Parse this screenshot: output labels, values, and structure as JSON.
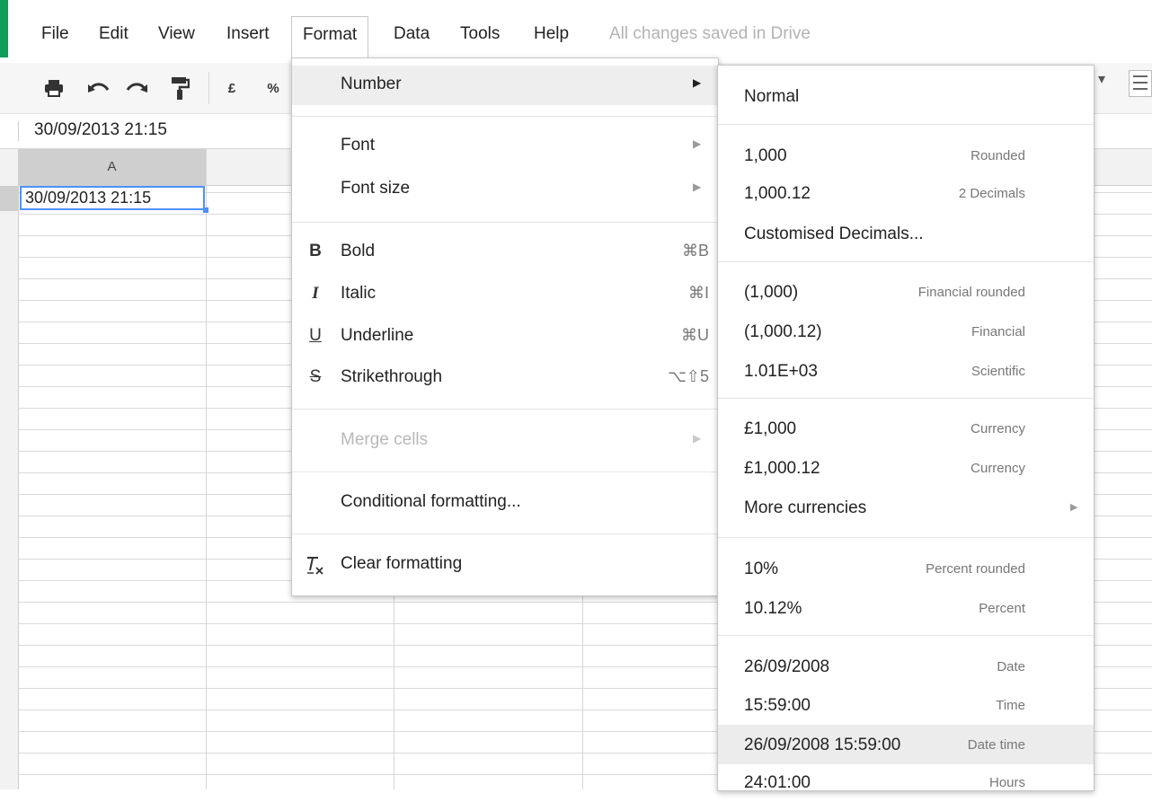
{
  "menubar": {
    "items": [
      "File",
      "Edit",
      "View",
      "Insert",
      "Format",
      "Data",
      "Tools",
      "Help"
    ],
    "active": "Format",
    "save_status": "All changes saved in Drive"
  },
  "toolbar": {
    "currency_label": "£",
    "percent_label": "%"
  },
  "formula_bar": {
    "value": "30/09/2013 21:15"
  },
  "sheet": {
    "column_a": "A",
    "cell_a1": "30/09/2013 21:15"
  },
  "format_menu": {
    "number": "Number",
    "font": "Font",
    "font_size": "Font size",
    "bold": "Bold",
    "bold_shortcut": "⌘B",
    "italic": "Italic",
    "italic_shortcut": "⌘I",
    "underline": "Underline",
    "underline_shortcut": "⌘U",
    "strikethrough": "Strikethrough",
    "strikethrough_shortcut": "⌥⇧5",
    "merge_cells": "Merge cells",
    "conditional_formatting": "Conditional formatting...",
    "clear_formatting": "Clear formatting",
    "icon_bold": "B",
    "icon_italic": "I",
    "icon_underline": "U",
    "icon_strike": "S"
  },
  "number_submenu": {
    "normal": "Normal",
    "rounded_value": "1,000",
    "rounded_desc": "Rounded",
    "decimals_value": "1,000.12",
    "decimals_desc": "2 Decimals",
    "custom_decimals": "Customised Decimals...",
    "fin_rounded_value": "(1,000)",
    "fin_rounded_desc": "Financial rounded",
    "financial_value": "(1,000.12)",
    "financial_desc": "Financial",
    "scientific_value": "1.01E+03",
    "scientific_desc": "Scientific",
    "currency1_value": "£1,000",
    "currency1_desc": "Currency",
    "currency2_value": "£1,000.12",
    "currency2_desc": "Currency",
    "more_currencies": "More currencies",
    "pct_rounded_value": "10%",
    "pct_rounded_desc": "Percent rounded",
    "percent_value": "10.12%",
    "percent_desc": "Percent",
    "date_value": "26/09/2008",
    "date_desc": "Date",
    "time_value": "15:59:00",
    "time_desc": "Time",
    "datetime_value": "26/09/2008 15:59:00",
    "datetime_desc": "Date time",
    "hours_value": "24:01:00",
    "hours_desc": "Hours"
  },
  "colors": {
    "accent": "#0f9d58",
    "selection": "#4d90fe"
  }
}
